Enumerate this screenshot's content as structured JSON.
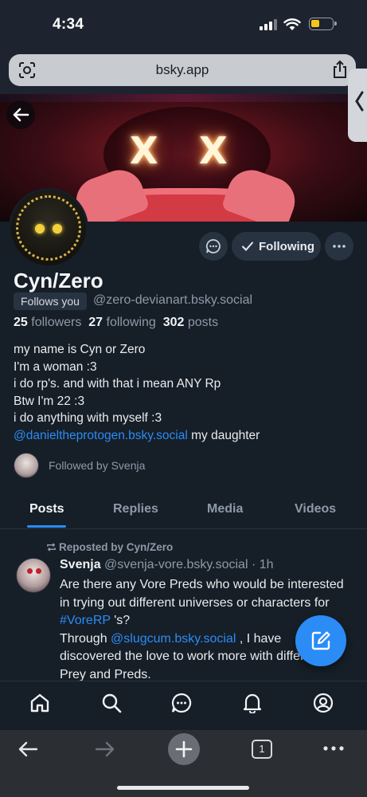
{
  "status": {
    "time": "4:34"
  },
  "browser": {
    "url": "bsky.app",
    "tab_count": "1"
  },
  "profile": {
    "display_name": "Cyn/Zero",
    "follows_you": "Follows you",
    "handle": "@zero-devianart.bsky.social",
    "followers_count": "25",
    "followers_label": "followers",
    "following_count": "27",
    "following_label": "following",
    "posts_count": "302",
    "posts_label": "posts",
    "following_button": "Following",
    "bio_lines": [
      "my name is Cyn or Zero",
      "I'm a woman :3",
      "i do rp's. and with that i mean ANY Rp",
      "Btw I'm 22 :3",
      "i do anything with myself :3"
    ],
    "bio_mention": "@danieltheprotogen.bsky.social",
    "bio_mention_suffix": " my daughter",
    "followed_by": "Followed by Svenja"
  },
  "tabs": [
    "Posts",
    "Replies",
    "Media",
    "Videos"
  ],
  "post": {
    "repost_label": "Reposted by Cyn/Zero",
    "author_name": "Svenja",
    "author_handle": "@svenja-vore.bsky.social",
    "time_ago": "· 1h",
    "text_part1": "Are there any Vore Preds who would be interested in trying out different universes or characters for ",
    "hashtag": "#VoreRP",
    "text_part2": " 's?",
    "text_part3": "Through ",
    "mention": "@slugcum.bsky.social",
    "text_part4": " , I have discovered the love to work more with different Prey and Preds."
  },
  "colors": {
    "accent": "#2b8cf5",
    "background": "#161e27",
    "muted": "#8e9aa8"
  }
}
